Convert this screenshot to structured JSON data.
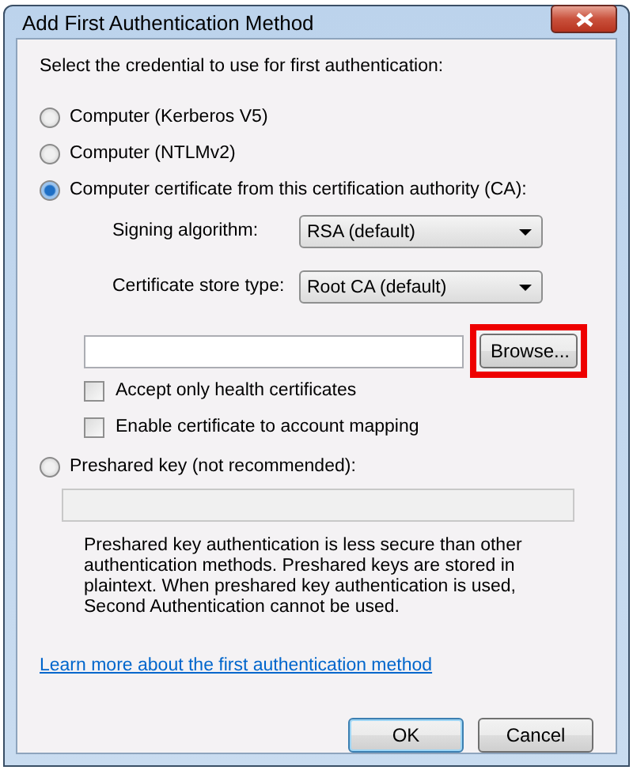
{
  "window": {
    "title": "Add First Authentication Method"
  },
  "instruction": "Select the credential to use for first authentication:",
  "options": [
    {
      "kind": "plain",
      "label": "Computer (Kerberos V5)",
      "selected": false
    },
    {
      "kind": "plain",
      "label": "Computer (NTLMv2)",
      "selected": false
    },
    {
      "kind": "certificate",
      "label": "Computer certificate from this certification authority (CA):",
      "selected": true
    },
    {
      "kind": "preshared",
      "label": "Preshared key (not recommended):",
      "selected": false
    }
  ],
  "certificate": {
    "fields": [
      {
        "label": "Signing algorithm:",
        "value": "RSA (default)"
      },
      {
        "label": "Certificate store type:",
        "value": "Root CA (default)"
      }
    ],
    "browse_button": {
      "label": "Browse...",
      "highlighted": true
    },
    "checkboxes": [
      {
        "label": "Accept only health certificates",
        "checked": false
      },
      {
        "label": "Enable certificate to account mapping",
        "checked": false
      }
    ]
  },
  "preshared": {
    "disabled": true,
    "note": "Preshared key authentication is less secure than other authentication methods. Preshared keys are stored in plaintext. When preshared key authentication is used, Second Authentication cannot be used."
  },
  "link": "Learn more about the first authentication method",
  "buttons": [
    {
      "label": "OK",
      "default": true
    },
    {
      "label": "Cancel",
      "default": false
    }
  ]
}
